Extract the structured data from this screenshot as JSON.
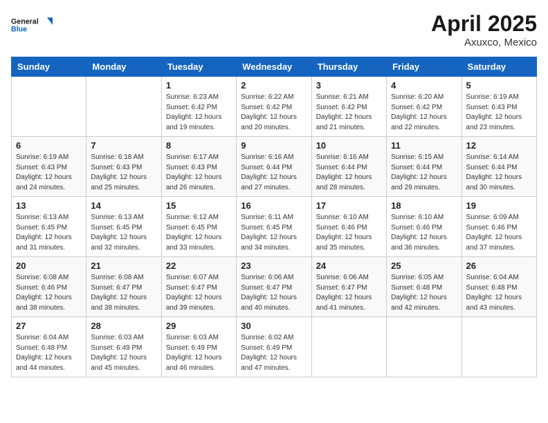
{
  "header": {
    "logo_line1": "General",
    "logo_line2": "Blue",
    "month": "April 2025",
    "location": "Axuxco, Mexico"
  },
  "weekdays": [
    "Sunday",
    "Monday",
    "Tuesday",
    "Wednesday",
    "Thursday",
    "Friday",
    "Saturday"
  ],
  "weeks": [
    [
      {
        "day": "",
        "info": ""
      },
      {
        "day": "",
        "info": ""
      },
      {
        "day": "1",
        "info": "Sunrise: 6:23 AM\nSunset: 6:42 PM\nDaylight: 12 hours and 19 minutes."
      },
      {
        "day": "2",
        "info": "Sunrise: 6:22 AM\nSunset: 6:42 PM\nDaylight: 12 hours and 20 minutes."
      },
      {
        "day": "3",
        "info": "Sunrise: 6:21 AM\nSunset: 6:42 PM\nDaylight: 12 hours and 21 minutes."
      },
      {
        "day": "4",
        "info": "Sunrise: 6:20 AM\nSunset: 6:42 PM\nDaylight: 12 hours and 22 minutes."
      },
      {
        "day": "5",
        "info": "Sunrise: 6:19 AM\nSunset: 6:43 PM\nDaylight: 12 hours and 23 minutes."
      }
    ],
    [
      {
        "day": "6",
        "info": "Sunrise: 6:19 AM\nSunset: 6:43 PM\nDaylight: 12 hours and 24 minutes."
      },
      {
        "day": "7",
        "info": "Sunrise: 6:18 AM\nSunset: 6:43 PM\nDaylight: 12 hours and 25 minutes."
      },
      {
        "day": "8",
        "info": "Sunrise: 6:17 AM\nSunset: 6:43 PM\nDaylight: 12 hours and 26 minutes."
      },
      {
        "day": "9",
        "info": "Sunrise: 6:16 AM\nSunset: 6:44 PM\nDaylight: 12 hours and 27 minutes."
      },
      {
        "day": "10",
        "info": "Sunrise: 6:16 AM\nSunset: 6:44 PM\nDaylight: 12 hours and 28 minutes."
      },
      {
        "day": "11",
        "info": "Sunrise: 6:15 AM\nSunset: 6:44 PM\nDaylight: 12 hours and 29 minutes."
      },
      {
        "day": "12",
        "info": "Sunrise: 6:14 AM\nSunset: 6:44 PM\nDaylight: 12 hours and 30 minutes."
      }
    ],
    [
      {
        "day": "13",
        "info": "Sunrise: 6:13 AM\nSunset: 6:45 PM\nDaylight: 12 hours and 31 minutes."
      },
      {
        "day": "14",
        "info": "Sunrise: 6:13 AM\nSunset: 6:45 PM\nDaylight: 12 hours and 32 minutes."
      },
      {
        "day": "15",
        "info": "Sunrise: 6:12 AM\nSunset: 6:45 PM\nDaylight: 12 hours and 33 minutes."
      },
      {
        "day": "16",
        "info": "Sunrise: 6:11 AM\nSunset: 6:45 PM\nDaylight: 12 hours and 34 minutes."
      },
      {
        "day": "17",
        "info": "Sunrise: 6:10 AM\nSunset: 6:46 PM\nDaylight: 12 hours and 35 minutes."
      },
      {
        "day": "18",
        "info": "Sunrise: 6:10 AM\nSunset: 6:46 PM\nDaylight: 12 hours and 36 minutes."
      },
      {
        "day": "19",
        "info": "Sunrise: 6:09 AM\nSunset: 6:46 PM\nDaylight: 12 hours and 37 minutes."
      }
    ],
    [
      {
        "day": "20",
        "info": "Sunrise: 6:08 AM\nSunset: 6:46 PM\nDaylight: 12 hours and 38 minutes."
      },
      {
        "day": "21",
        "info": "Sunrise: 6:08 AM\nSunset: 6:47 PM\nDaylight: 12 hours and 38 minutes."
      },
      {
        "day": "22",
        "info": "Sunrise: 6:07 AM\nSunset: 6:47 PM\nDaylight: 12 hours and 39 minutes."
      },
      {
        "day": "23",
        "info": "Sunrise: 6:06 AM\nSunset: 6:47 PM\nDaylight: 12 hours and 40 minutes."
      },
      {
        "day": "24",
        "info": "Sunrise: 6:06 AM\nSunset: 6:47 PM\nDaylight: 12 hours and 41 minutes."
      },
      {
        "day": "25",
        "info": "Sunrise: 6:05 AM\nSunset: 6:48 PM\nDaylight: 12 hours and 42 minutes."
      },
      {
        "day": "26",
        "info": "Sunrise: 6:04 AM\nSunset: 6:48 PM\nDaylight: 12 hours and 43 minutes."
      }
    ],
    [
      {
        "day": "27",
        "info": "Sunrise: 6:04 AM\nSunset: 6:48 PM\nDaylight: 12 hours and 44 minutes."
      },
      {
        "day": "28",
        "info": "Sunrise: 6:03 AM\nSunset: 6:49 PM\nDaylight: 12 hours and 45 minutes."
      },
      {
        "day": "29",
        "info": "Sunrise: 6:03 AM\nSunset: 6:49 PM\nDaylight: 12 hours and 46 minutes."
      },
      {
        "day": "30",
        "info": "Sunrise: 6:02 AM\nSunset: 6:49 PM\nDaylight: 12 hours and 47 minutes."
      },
      {
        "day": "",
        "info": ""
      },
      {
        "day": "",
        "info": ""
      },
      {
        "day": "",
        "info": ""
      }
    ]
  ]
}
